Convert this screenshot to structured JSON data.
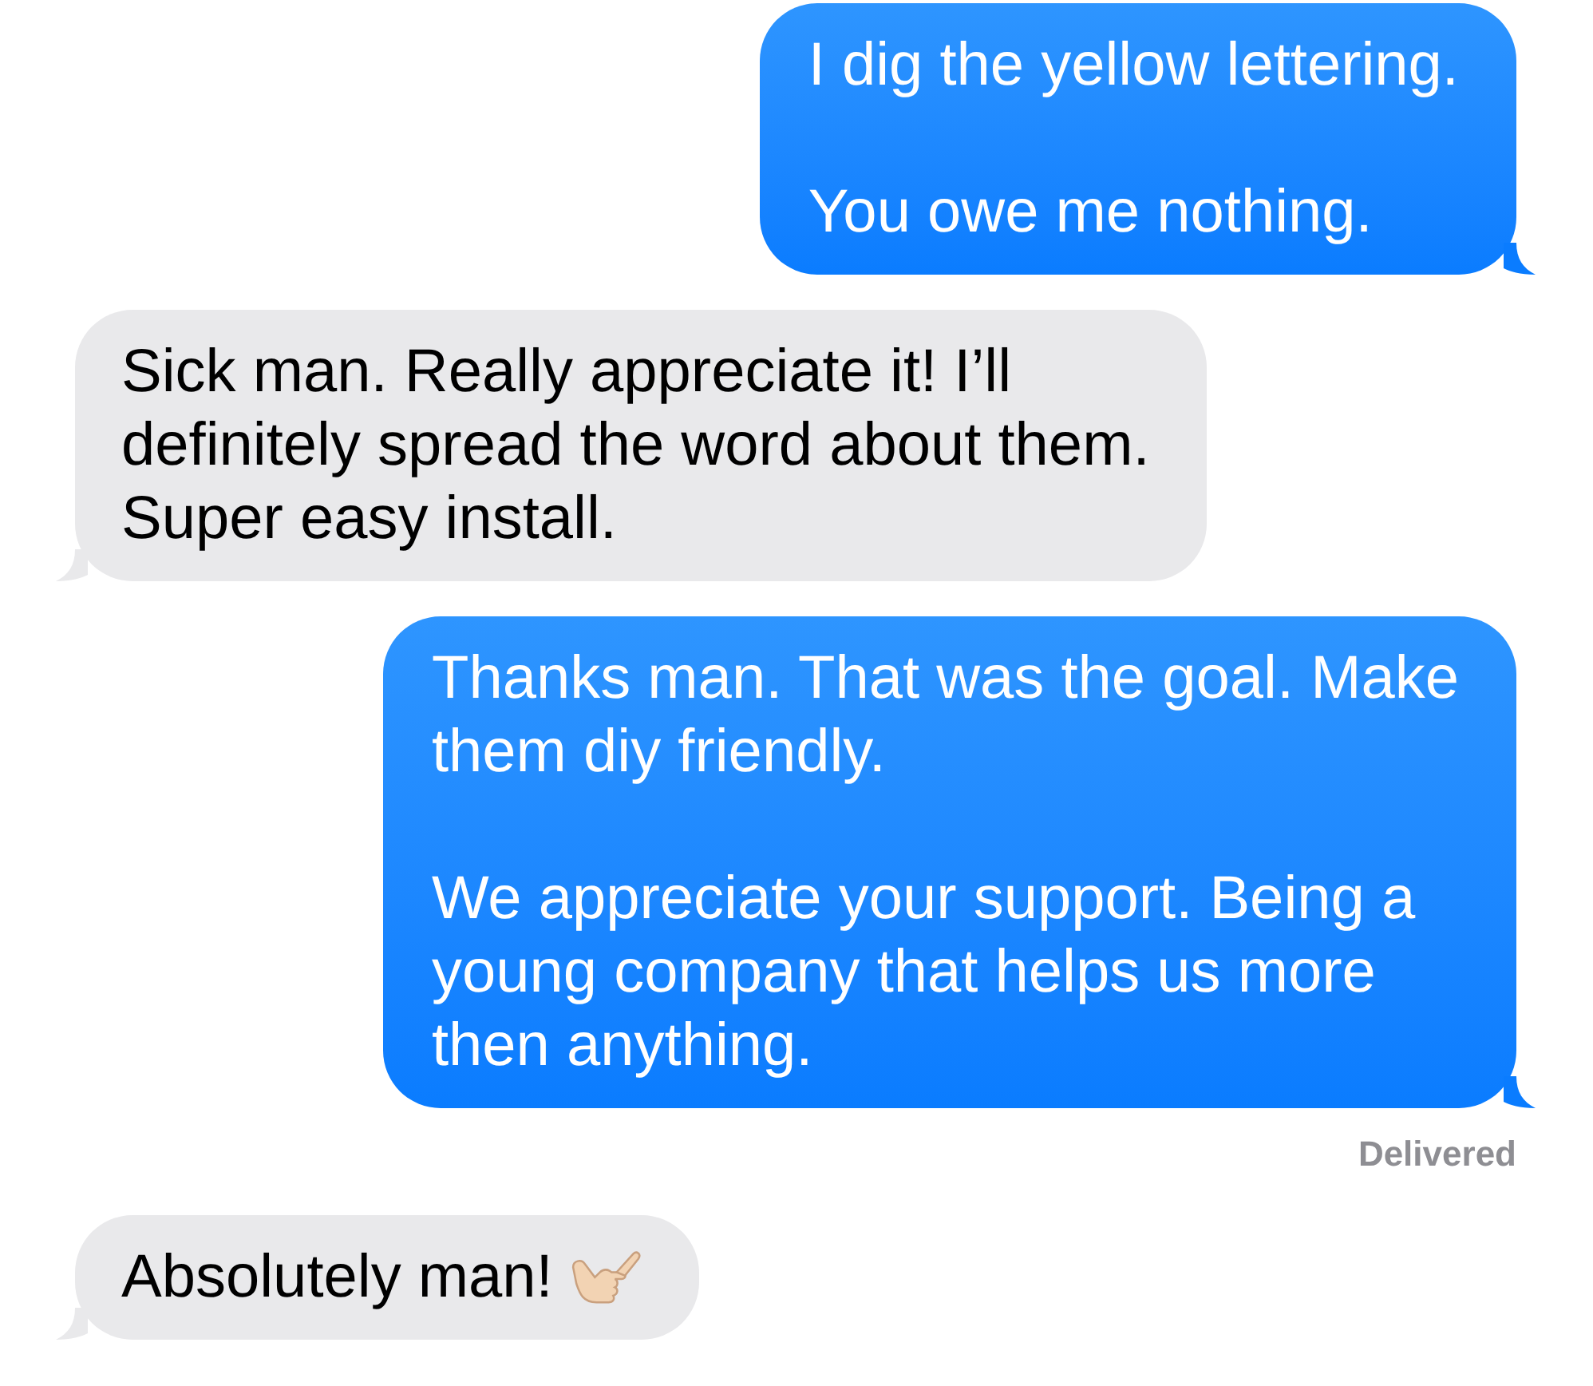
{
  "messages": [
    {
      "kind": "sent",
      "paragraphs": [
        [
          "I dig the yellow lettering."
        ],
        [
          "You owe me nothing."
        ]
      ]
    },
    {
      "kind": "received",
      "paragraphs": [
        [
          "Sick man. Really appreciate it! I’ll",
          "definitely spread the word about them.",
          "Super easy install."
        ]
      ]
    },
    {
      "kind": "sent",
      "paragraphs": [
        [
          "Thanks man. That was the goal. Make",
          "them diy friendly."
        ],
        [
          "We appreciate your support. Being a",
          "young company that helps us more",
          "then anything."
        ]
      ],
      "status": "Delivered"
    },
    {
      "kind": "received",
      "paragraphs": [
        [
          "Absolutely man!"
        ]
      ],
      "emoji": true
    }
  ]
}
